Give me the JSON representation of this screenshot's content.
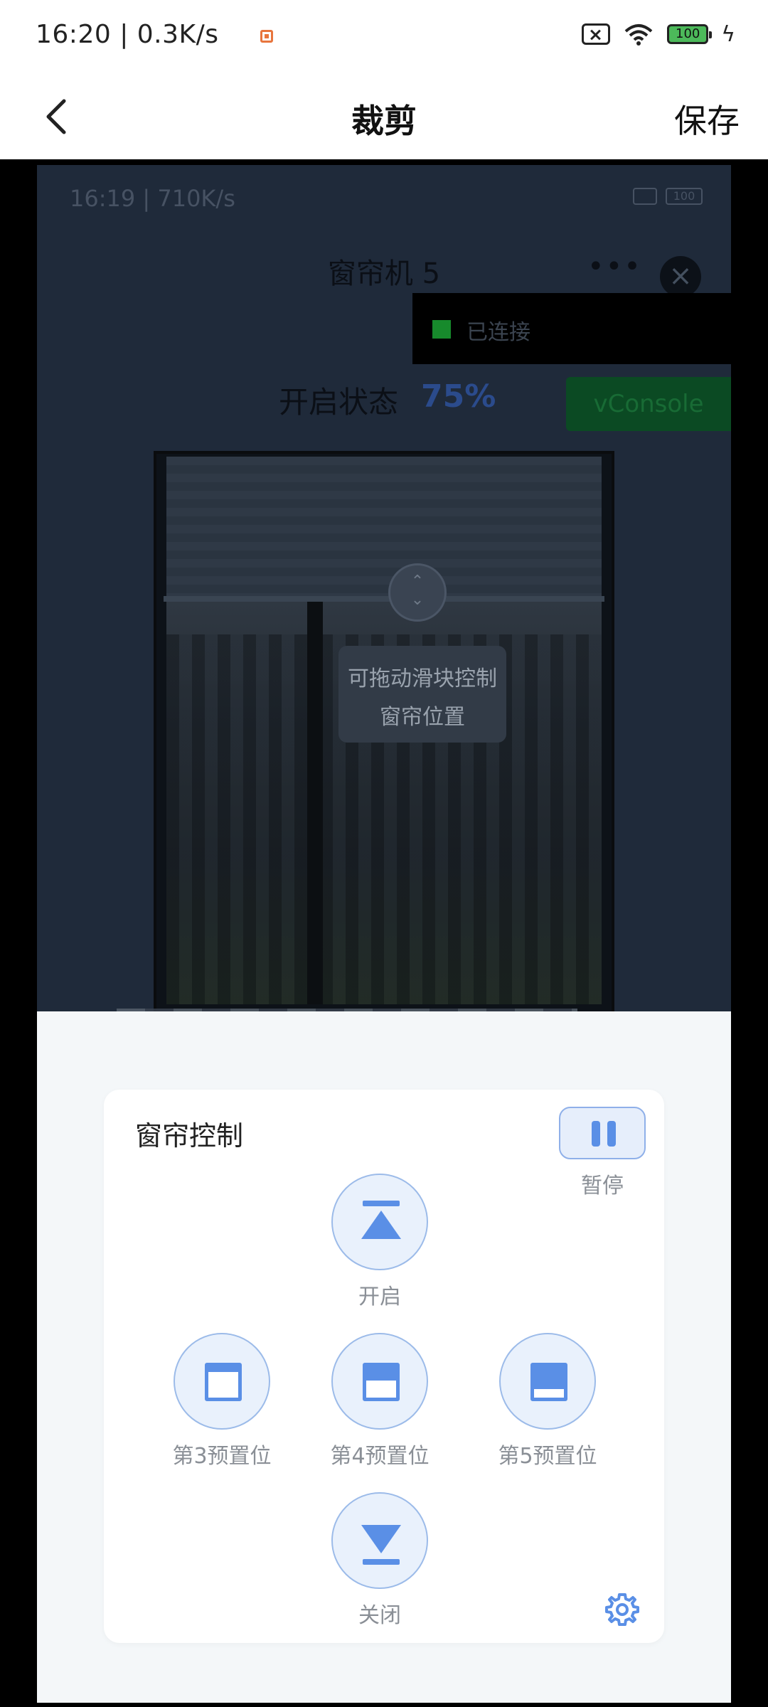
{
  "status_bar": {
    "time": "16:20 | 0.3K/s",
    "battery": "100"
  },
  "app_bar": {
    "title": "裁剪",
    "save": "保存"
  },
  "inner": {
    "status_time": "16:19 | 710K/s",
    "battery": "100",
    "title": "窗帘机 5",
    "menu": "•••",
    "close": "×",
    "connected": "已连接",
    "state_label": "开启状态",
    "state_value": "75%",
    "vconsole": "vConsole",
    "tip": "可拖动滑块控制窗帘位置"
  },
  "control": {
    "title": "窗帘控制",
    "pause": "暂停",
    "open": "开启",
    "preset3": "第3预置位",
    "preset4": "第4预置位",
    "preset5": "第5预置位",
    "close": "关闭"
  },
  "colors": {
    "accent": "#5a8fe6",
    "connected": "#178a2c",
    "vconsole": "#0b4a23"
  }
}
